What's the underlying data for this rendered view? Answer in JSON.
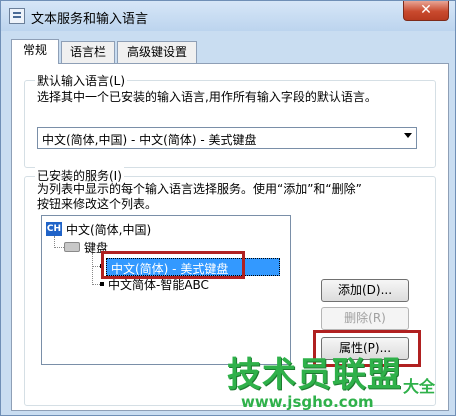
{
  "window": {
    "title": "文本服务和输入语言",
    "close_label": "✕"
  },
  "tabs": [
    "常规",
    "语言栏",
    "高级键设置"
  ],
  "default_language": {
    "heading": "默认输入语言(L)",
    "description": "选择其中一个已安装的输入语言,用作所有输入字段的默认语言。",
    "selected_value": "中文(简体,中国) - 中文(简体) - 美式键盘"
  },
  "installed_services": {
    "heading": "已安装的服务(I)",
    "description_line1": "为列表中显示的每个输入语言选择服务。使用“添加”和“删除”",
    "description_line2": "按钮来修改这个列表。",
    "tree": {
      "language_badge": "CH",
      "language": "中文(简体,中国)",
      "category": "键盘",
      "items": [
        "中文(简体) - 美式键盘",
        "中文简体-智能ABC"
      ]
    }
  },
  "buttons": {
    "add": "添加(D)...",
    "remove": "删除(R)",
    "properties": "属性(P)..."
  },
  "watermark": {
    "brand": "技术员联盟",
    "daquan": "大全",
    "url": "www.jsgho.com"
  },
  "colors": {
    "selection": "#3399ff",
    "highlight_box": "#b02020",
    "watermark": "#2fb14a"
  }
}
